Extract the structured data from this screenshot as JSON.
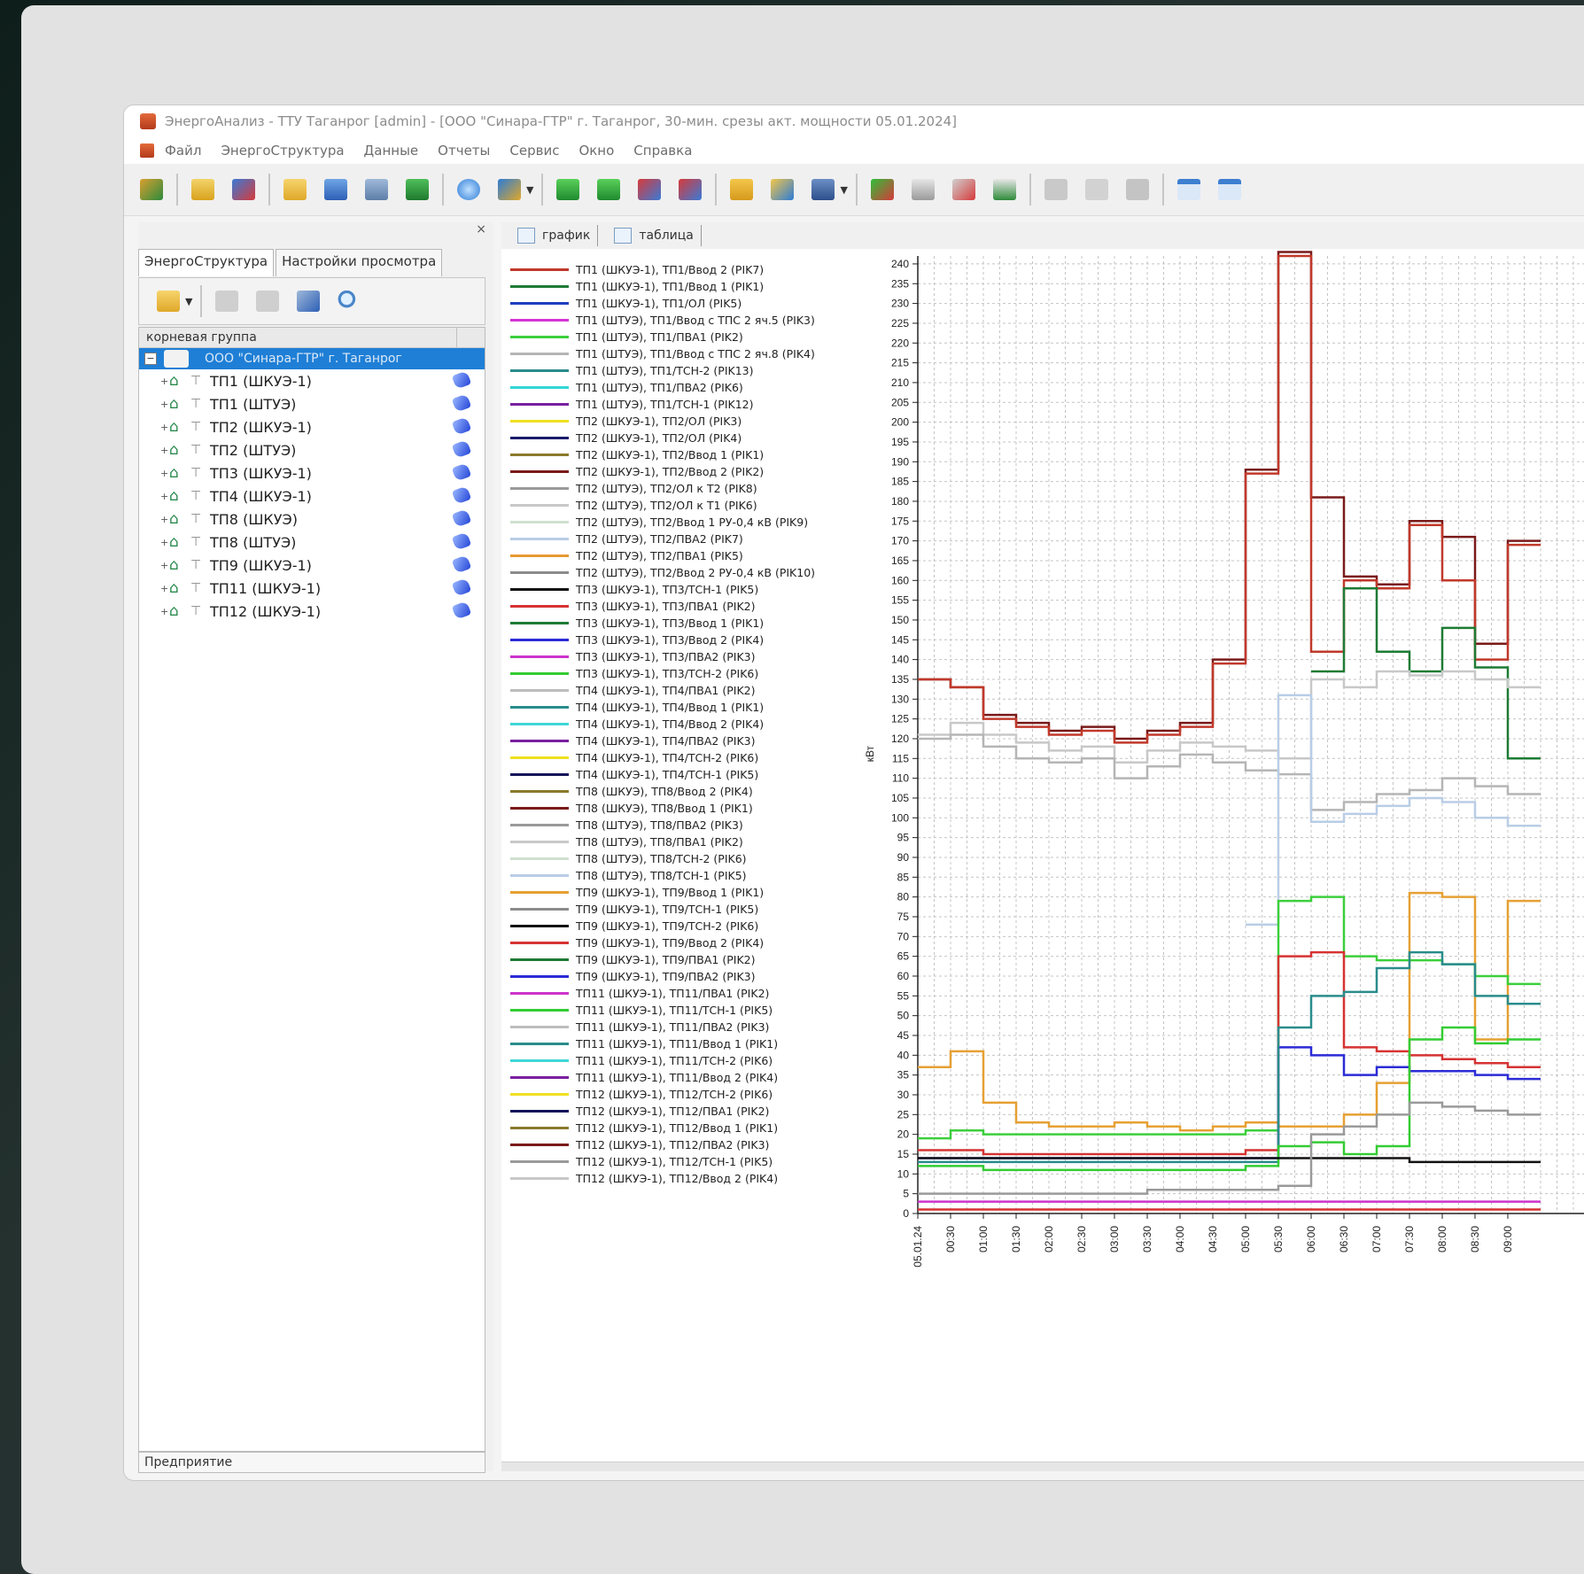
{
  "window": {
    "title": "ЭнергоАнализ - ТТУ Таганрог [admin] - [ООО \"Синара-ГТР\" г. Таганрог, 30-мин. срезы акт. мощности 05.01.2024]"
  },
  "menu": [
    "Файл",
    "ЭнергоСтруктура",
    "Данные",
    "Отчеты",
    "Сервис",
    "Окно",
    "Справка"
  ],
  "left_panel": {
    "close_glyph": "×",
    "tabs": [
      "ЭнергоСтруктура",
      "Настройки просмотра"
    ],
    "tree_header": "корневая группа",
    "root": "ООО \"Синара-ГТР\" г. Таганрог",
    "items": [
      "ТП1 (ШКУЭ-1)",
      "ТП1 (ШТУЭ)",
      "ТП2 (ШКУЭ-1)",
      "ТП2 (ШТУЭ)",
      "ТП3 (ШКУЭ-1)",
      "ТП4 (ШКУЭ-1)",
      "ТП8 (ШКУЭ)",
      "ТП8 (ШТУЭ)",
      "ТП9 (ШКУЭ-1)",
      "ТП11 (ШКУЭ-1)",
      "ТП12 (ШКУЭ-1)"
    ],
    "footer": "Предприятие"
  },
  "main_tabs": [
    "график",
    "таблица"
  ],
  "legend": [
    {
      "label": "ТП1 (ШКУЭ-1), ТП1/Ввод 2 (PIK7)",
      "color": "#c0392b"
    },
    {
      "label": "ТП1 (ШКУЭ-1), ТП1/Ввод 1 (PIK1)",
      "color": "#1e7b34"
    },
    {
      "label": "ТП1 (ШКУЭ-1), ТП1/ОЛ (PIK5)",
      "color": "#1f3fbf"
    },
    {
      "label": "ТП1 (ШТУЭ), ТП1/Ввод с ТПС 2 яч.5 (PIK3)",
      "color": "#d633d6"
    },
    {
      "label": "ТП1 (ШТУЭ), ТП1/ПВА1 (PIK2)",
      "color": "#3ccf3c"
    },
    {
      "label": "ТП1 (ШТУЭ), ТП1/Ввод с ТПС 2 яч.8 (PIK4)",
      "color": "#b5b5b5"
    },
    {
      "label": "ТП1 (ШТУЭ), ТП1/ТСН-2 (PIK13)",
      "color": "#2a8c8c"
    },
    {
      "label": "ТП1 (ШТУЭ), ТП1/ПВА2 (PIK6)",
      "color": "#33d6d6"
    },
    {
      "label": "ТП1 (ШТУЭ), ТП1/ТСН-1 (PIK12)",
      "color": "#7a1fa0"
    },
    {
      "label": "ТП2 (ШКУЭ-1), ТП2/ОЛ (PIK3)",
      "color": "#f0e020"
    },
    {
      "label": "ТП2 (ШКУЭ-1), ТП2/ОЛ (PIK4)",
      "color": "#1a1a6b"
    },
    {
      "label": "ТП2 (ШКУЭ-1), ТП2/Ввод 1 (PIK1)",
      "color": "#8a7a2a"
    },
    {
      "label": "ТП2 (ШКУЭ-1), ТП2/Ввод 2 (PIK2)",
      "color": "#7a1a1a"
    },
    {
      "label": "ТП2 (ШТУЭ), ТП2/ОЛ к Т2 (PIK8)",
      "color": "#9a9a9a"
    },
    {
      "label": "ТП2 (ШТУЭ), ТП2/ОЛ к Т1 (PIK6)",
      "color": "#c8c8c8"
    },
    {
      "label": "ТП2 (ШТУЭ), ТП2/Ввод 1 РУ-0,4 кВ (PIK9)",
      "color": "#cfe0cf"
    },
    {
      "label": "ТП2 (ШТУЭ), ТП2/ПВА2 (PIK7)",
      "color": "#b9cde6"
    },
    {
      "label": "ТП2 (ШТУЭ), ТП2/ПВА1 (PIK5)",
      "color": "#e69a33"
    },
    {
      "label": "ТП2 (ШТУЭ), ТП2/Ввод 2 РУ-0,4 кВ (PIK10)",
      "color": "#8c8c8c"
    },
    {
      "label": "ТП3 (ШКУЭ-1), ТП3/ТСН-1 (PIK5)",
      "color": "#111111"
    },
    {
      "label": "ТП3 (ШКУЭ-1), ТП3/ПВА1 (PIK2)",
      "color": "#d63333"
    },
    {
      "label": "ТП3 (ШКУЭ-1), ТП3/Ввод 1 (PIK1)",
      "color": "#1e7b34"
    },
    {
      "label": "ТП3 (ШКУЭ-1), ТП3/Ввод 2 (PIK4)",
      "color": "#2b2bd6"
    },
    {
      "label": "ТП3 (ШКУЭ-1), ТП3/ПВА2 (PIK3)",
      "color": "#cc33cc"
    },
    {
      "label": "ТП3 (ШКУЭ-1), ТП3/ТСН-2 (PIK6)",
      "color": "#33cc33"
    },
    {
      "label": "ТП4 (ШКУЭ-1), ТП4/ПВА1 (PIK2)",
      "color": "#bdbdbd"
    },
    {
      "label": "ТП4 (ШКУЭ-1), ТП4/Ввод 1 (PIK1)",
      "color": "#2a8c8c"
    },
    {
      "label": "ТП4 (ШКУЭ-1), ТП4/Ввод 2 (PIK4)",
      "color": "#40d6d6"
    },
    {
      "label": "ТП4 (ШКУЭ-1), ТП4/ПВА2 (PIK3)",
      "color": "#7a1fa0"
    },
    {
      "label": "ТП4 (ШКУЭ-1), ТП4/ТСН-2 (PIK6)",
      "color": "#f0e020"
    },
    {
      "label": "ТП4 (ШКУЭ-1), ТП4/ТСН-1 (PIK5)",
      "color": "#14145a"
    },
    {
      "label": "ТП8 (ШКУЭ), ТП8/Ввод 2 (PIK4)",
      "color": "#8a7a2a"
    },
    {
      "label": "ТП8 (ШКУЭ), ТП8/Ввод 1 (PIK1)",
      "color": "#7a1a1a"
    },
    {
      "label": "ТП8 (ШТУЭ), ТП8/ПВА2 (PIK3)",
      "color": "#9a9a9a"
    },
    {
      "label": "ТП8 (ШТУЭ), ТП8/ПВА1 (PIK2)",
      "color": "#c8c8c8"
    },
    {
      "label": "ТП8 (ШТУЭ), ТП8/ТСН-2 (PIK6)",
      "color": "#cfe0cf"
    },
    {
      "label": "ТП8 (ШТУЭ), ТП8/ТСН-1 (PIK5)",
      "color": "#b9cde6"
    },
    {
      "label": "ТП9 (ШКУЭ-1), ТП9/Ввод 1 (PIK1)",
      "color": "#e6a033"
    },
    {
      "label": "ТП9 (ШКУЭ-1), ТП9/ТСН-1 (PIK5)",
      "color": "#8c8c8c"
    },
    {
      "label": "ТП9 (ШКУЭ-1), ТП9/ТСН-2 (PIK6)",
      "color": "#111111"
    },
    {
      "label": "ТП9 (ШКУЭ-1), ТП9/Ввод 2 (PIK4)",
      "color": "#d63333"
    },
    {
      "label": "ТП9 (ШКУЭ-1), ТП9/ПВА1 (PIK2)",
      "color": "#1e7b34"
    },
    {
      "label": "ТП9 (ШКУЭ-1), ТП9/ПВА2 (PIK3)",
      "color": "#2b2bd6"
    },
    {
      "label": "ТП11 (ШКУЭ-1), ТП11/ПВА1 (PIK2)",
      "color": "#cc33cc"
    },
    {
      "label": "ТП11 (ШКУЭ-1), ТП11/ТСН-1 (PIK5)",
      "color": "#33cc33"
    },
    {
      "label": "ТП11 (ШКУЭ-1), ТП11/ПВА2 (PIK3)",
      "color": "#bdbdbd"
    },
    {
      "label": "ТП11 (ШКУЭ-1), ТП11/Ввод 1 (PIK1)",
      "color": "#2a8c8c"
    },
    {
      "label": "ТП11 (ШКУЭ-1), ТП11/ТСН-2 (PIK6)",
      "color": "#40d6d6"
    },
    {
      "label": "ТП11 (ШКУЭ-1), ТП11/Ввод 2 (PIK4)",
      "color": "#7a1fa0"
    },
    {
      "label": "ТП12 (ШКУЭ-1), ТП12/ТСН-2 (PIK6)",
      "color": "#f0e020"
    },
    {
      "label": "ТП12 (ШКУЭ-1), ТП12/ПВА1 (PIK2)",
      "color": "#14145a"
    },
    {
      "label": "ТП12 (ШКУЭ-1), ТП12/Ввод 1 (PIK1)",
      "color": "#8a7a2a"
    },
    {
      "label": "ТП12 (ШКУЭ-1), ТП12/ПВА2 (PIK3)",
      "color": "#7a1a1a"
    },
    {
      "label": "ТП12 (ШКУЭ-1), ТП12/ТСН-1 (PIK5)",
      "color": "#9a9a9a"
    },
    {
      "label": "ТП12 (ШКУЭ-1), ТП12/Ввод 2 (PIK4)",
      "color": "#c8c8c8"
    }
  ],
  "chart_data": {
    "type": "line",
    "step": true,
    "ylabel": "кВт",
    "ylim": [
      0,
      242
    ],
    "ytick_step": 5,
    "grid": true,
    "categories": [
      "05.01.24",
      "00:30",
      "01:00",
      "01:30",
      "02:00",
      "02:30",
      "03:00",
      "03:30",
      "04:00",
      "04:30",
      "05:00",
      "05:30",
      "06:00",
      "06:30",
      "07:00",
      "07:30",
      "08:00",
      "08:30",
      "09:00"
    ],
    "series": [
      {
        "color": "#7a1a1a",
        "values": [
          135,
          133,
          126,
          124,
          122,
          123,
          120,
          122,
          124,
          140,
          188,
          243,
          181,
          161,
          159,
          175,
          171,
          144,
          170
        ]
      },
      {
        "color": "#c0392b",
        "values": [
          135,
          133,
          125,
          123,
          121,
          122,
          119,
          121,
          123,
          139,
          187,
          242,
          142,
          160,
          158,
          174,
          160,
          140,
          169
        ]
      },
      {
        "color": "#1e7b34",
        "values": [
          null,
          null,
          null,
          null,
          null,
          null,
          null,
          null,
          null,
          null,
          null,
          null,
          137,
          158,
          142,
          137,
          148,
          138,
          115
        ]
      },
      {
        "color": "#c8c8c8",
        "values": [
          121,
          124,
          121,
          119,
          117,
          118,
          114,
          117,
          119,
          118,
          117,
          115,
          135,
          133,
          137,
          136,
          137,
          135,
          133
        ]
      },
      {
        "color": "#b5b5b5",
        "values": [
          120,
          121,
          118,
          115,
          114,
          115,
          110,
          113,
          116,
          114,
          112,
          111,
          102,
          104,
          106,
          107,
          110,
          108,
          106
        ]
      },
      {
        "color": "#b9cde6",
        "values": [
          null,
          null,
          null,
          null,
          null,
          null,
          null,
          null,
          null,
          null,
          73,
          131,
          99,
          101,
          103,
          105,
          104,
          100,
          98
        ]
      },
      {
        "color": "#e6a033",
        "values": [
          37,
          41,
          28,
          23,
          22,
          22,
          23,
          22,
          21,
          22,
          23,
          22,
          22,
          25,
          33,
          81,
          80,
          44,
          79
        ]
      },
      {
        "color": "#3ccf3c",
        "values": [
          19,
          21,
          20,
          20,
          20,
          20,
          20,
          20,
          20,
          20,
          21,
          79,
          80,
          65,
          64,
          64,
          63,
          60,
          58
        ]
      },
      {
        "color": "#d63333",
        "values": [
          16,
          16,
          15,
          15,
          15,
          15,
          15,
          15,
          15,
          15,
          16,
          65,
          66,
          42,
          41,
          40,
          39,
          38,
          37
        ]
      },
      {
        "color": "#2b2bd6",
        "values": [
          14,
          14,
          14,
          14,
          14,
          14,
          14,
          14,
          14,
          14,
          14,
          42,
          40,
          35,
          37,
          36,
          36,
          35,
          34
        ]
      },
      {
        "color": "#2a8c8c",
        "values": [
          13,
          13,
          13,
          13,
          13,
          13,
          13,
          13,
          13,
          13,
          13,
          47,
          55,
          56,
          62,
          66,
          63,
          55,
          53
        ]
      },
      {
        "color": "#33cc33",
        "values": [
          12,
          12,
          11,
          11,
          11,
          11,
          11,
          11,
          11,
          11,
          12,
          17,
          18,
          15,
          17,
          44,
          47,
          43,
          44
        ]
      },
      {
        "color": "#111111",
        "values": [
          14,
          14,
          14,
          14,
          14,
          14,
          14,
          14,
          14,
          14,
          14,
          14,
          14,
          14,
          14,
          13,
          13,
          13,
          13
        ]
      },
      {
        "color": "#9a9a9a",
        "values": [
          5,
          5,
          5,
          5,
          5,
          5,
          5,
          6,
          6,
          6,
          6,
          7,
          20,
          22,
          25,
          28,
          27,
          26,
          25
        ]
      },
      {
        "color": "#cc33cc",
        "values": [
          3,
          3,
          3,
          3,
          3,
          3,
          3,
          3,
          3,
          3,
          3,
          3,
          3,
          3,
          3,
          3,
          3,
          3,
          3
        ]
      },
      {
        "color": "#d63333",
        "values": [
          1,
          1,
          1,
          1,
          1,
          1,
          1,
          1,
          1,
          1,
          1,
          1,
          1,
          1,
          1,
          1,
          1,
          1,
          1
        ]
      }
    ]
  }
}
